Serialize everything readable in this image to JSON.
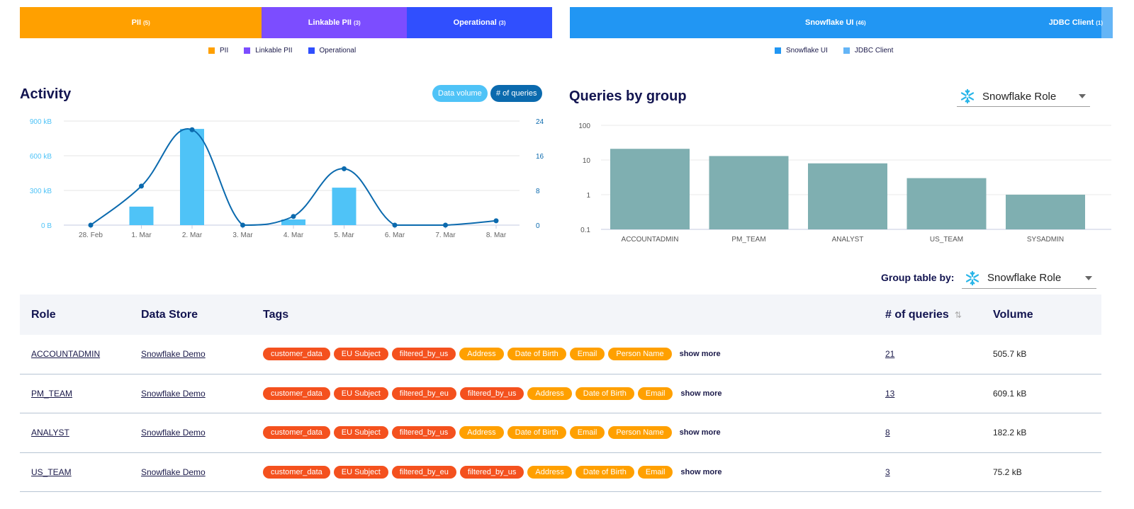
{
  "tag_categories": {
    "segments": [
      {
        "label": "PII",
        "count": "(5)",
        "value": 5,
        "color": "#ffa000"
      },
      {
        "label": "Linkable PII",
        "count": "(3)",
        "value": 3,
        "color": "#7c4dff"
      },
      {
        "label": "Operational",
        "count": "(3)",
        "value": 3,
        "color": "#304ffe"
      }
    ],
    "legend": [
      "PII",
      "Linkable PII",
      "Operational"
    ]
  },
  "clients": {
    "segments": [
      {
        "label": "Snowflake UI",
        "count": "(46)",
        "value": 46,
        "color": "#2196f3"
      },
      {
        "label": "JDBC Client",
        "count": "(1)",
        "value": 1,
        "color": "#64b5f6"
      }
    ],
    "legend": [
      "Snowflake UI",
      "JDBC Client"
    ]
  },
  "activity": {
    "title": "Activity",
    "toggles": {
      "volume": "Data volume",
      "queries": "# of queries"
    }
  },
  "queries_by_group": {
    "title": "Queries by group",
    "dropdown_value": "Snowflake Role"
  },
  "chart_data": [
    {
      "type": "bar+line",
      "title": "Activity",
      "categories": [
        "28. Feb",
        "1. Mar",
        "2. Mar",
        "3. Mar",
        "4. Mar",
        "5. Mar",
        "6. Mar",
        "7. Mar",
        "8. Mar"
      ],
      "series": [
        {
          "name": "Data volume",
          "type": "bar",
          "axis": "left",
          "unit": "kB",
          "color": "#4fc3f7",
          "values": [
            0,
            160,
            832,
            0,
            49,
            324,
            0,
            0,
            0
          ]
        },
        {
          "name": "# of queries",
          "type": "line",
          "axis": "right",
          "color": "#0b6aae",
          "values": [
            0,
            9,
            22,
            0,
            2,
            13,
            0,
            0,
            1
          ]
        }
      ],
      "left_axis": {
        "ticks": [
          "0 B",
          "300 kB",
          "600 kB",
          "900 kB"
        ],
        "range": [
          0,
          900
        ]
      },
      "right_axis": {
        "ticks": [
          "0",
          "8",
          "16",
          "24"
        ],
        "range": [
          0,
          24
        ]
      },
      "grid": true
    },
    {
      "type": "bar",
      "title": "Queries by group",
      "scale": "log",
      "categories": [
        "ACCOUNTADMIN",
        "PM_TEAM",
        "ANALYST",
        "US_TEAM",
        "SYSADMIN"
      ],
      "values": [
        21,
        13,
        8,
        3,
        1
      ],
      "color": "#7fafb1",
      "yticks": [
        "0.1",
        "1",
        "10",
        "100"
      ],
      "ylim": [
        0.1,
        100
      ],
      "grid": true
    }
  ],
  "table": {
    "group_by_label": "Group table by:",
    "group_by_value": "Snowflake Role",
    "headers": {
      "role": "Role",
      "store": "Data Store",
      "tags": "Tags",
      "queries": "# of queries",
      "volume": "Volume"
    },
    "show_more": "show more",
    "rows": [
      {
        "role": "ACCOUNTADMIN",
        "store": "Snowflake Demo",
        "tags": [
          {
            "t": "customer_data",
            "c": "red"
          },
          {
            "t": "EU Subject",
            "c": "red"
          },
          {
            "t": "filtered_by_us",
            "c": "red"
          },
          {
            "t": "Address",
            "c": "orange"
          },
          {
            "t": "Date of Birth",
            "c": "orange"
          },
          {
            "t": "Email",
            "c": "orange"
          },
          {
            "t": "Person Name",
            "c": "orange"
          }
        ],
        "queries": "21",
        "volume": "505.7 kB"
      },
      {
        "role": "PM_TEAM",
        "store": "Snowflake Demo",
        "tags": [
          {
            "t": "customer_data",
            "c": "red"
          },
          {
            "t": "EU Subject",
            "c": "red"
          },
          {
            "t": "filtered_by_eu",
            "c": "red"
          },
          {
            "t": "filtered_by_us",
            "c": "red"
          },
          {
            "t": "Address",
            "c": "orange"
          },
          {
            "t": "Date of Birth",
            "c": "orange"
          },
          {
            "t": "Email",
            "c": "orange"
          }
        ],
        "queries": "13",
        "volume": "609.1 kB"
      },
      {
        "role": "ANALYST",
        "store": "Snowflake Demo",
        "tags": [
          {
            "t": "customer_data",
            "c": "red"
          },
          {
            "t": "EU Subject",
            "c": "red"
          },
          {
            "t": "filtered_by_us",
            "c": "red"
          },
          {
            "t": "Address",
            "c": "orange"
          },
          {
            "t": "Date of Birth",
            "c": "orange"
          },
          {
            "t": "Email",
            "c": "orange"
          },
          {
            "t": "Person Name",
            "c": "orange"
          }
        ],
        "queries": "8",
        "volume": "182.2 kB"
      },
      {
        "role": "US_TEAM",
        "store": "Snowflake Demo",
        "tags": [
          {
            "t": "customer_data",
            "c": "red"
          },
          {
            "t": "EU Subject",
            "c": "red"
          },
          {
            "t": "filtered_by_eu",
            "c": "red"
          },
          {
            "t": "filtered_by_us",
            "c": "red"
          },
          {
            "t": "Address",
            "c": "orange"
          },
          {
            "t": "Date of Birth",
            "c": "orange"
          },
          {
            "t": "Email",
            "c": "orange"
          }
        ],
        "queries": "3",
        "volume": "75.2 kB"
      }
    ]
  }
}
